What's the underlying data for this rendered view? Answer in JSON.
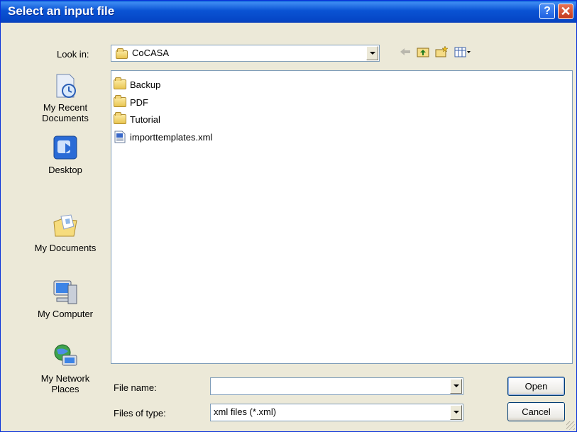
{
  "window": {
    "title": "Select an input file",
    "help_glyph": "?",
    "close_glyph": "✕"
  },
  "toolbar": {
    "look_in_label": "Look in:",
    "look_in_value": "CoCASA",
    "icons": [
      "back-arrow-icon",
      "up-folder-icon",
      "new-folder-icon",
      "views-menu-icon"
    ]
  },
  "places": [
    {
      "id": "recent",
      "label": "My Recent Documents",
      "icon": "recent-documents-icon"
    },
    {
      "id": "desktop",
      "label": "Desktop",
      "icon": "desktop-icon"
    },
    {
      "id": "documents",
      "label": "My Documents",
      "icon": "my-documents-icon"
    },
    {
      "id": "computer",
      "label": "My Computer",
      "icon": "my-computer-icon"
    },
    {
      "id": "network",
      "label": "My Network Places",
      "icon": "network-places-icon"
    }
  ],
  "files": [
    {
      "name": "Backup",
      "type": "folder"
    },
    {
      "name": "PDF",
      "type": "folder"
    },
    {
      "name": "Tutorial",
      "type": "folder"
    },
    {
      "name": "importtemplates.xml",
      "type": "xml"
    }
  ],
  "footer": {
    "file_name_label": "File name:",
    "file_name_value": "",
    "file_type_label": "Files of type:",
    "file_type_value": "xml files (*.xml)",
    "open_label": "Open",
    "cancel_label": "Cancel"
  },
  "colors": {
    "titlebar": "#0a53d4",
    "dialog_bg": "#ece9d8",
    "close_button": "#c4381b"
  }
}
